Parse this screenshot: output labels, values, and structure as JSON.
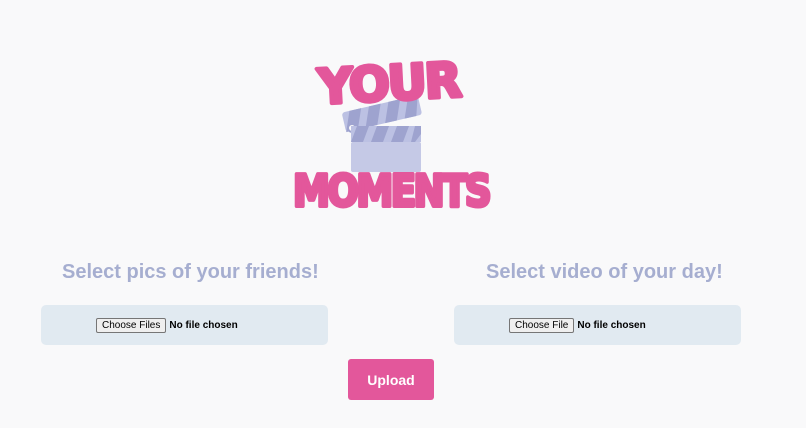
{
  "logo": {
    "word_top": "YOUR",
    "word_bottom": "MOMENTS",
    "icon": "clapperboard-icon",
    "colors": {
      "pink": "#e3579b",
      "clapper": "#c5c9e6",
      "clapper_dark": "#9ea3cf"
    }
  },
  "left": {
    "title": "Select pics of your friends!",
    "button_label": "Choose Files",
    "status": "No file chosen"
  },
  "right": {
    "title": "Select video of your day!",
    "button_label": "Choose File",
    "status": "No file chosen"
  },
  "upload": {
    "label": "Upload"
  },
  "colors": {
    "background": "#f9f9fa",
    "title": "#a6aed0",
    "box": "#e1eaf1",
    "accent": "#e3579b"
  }
}
